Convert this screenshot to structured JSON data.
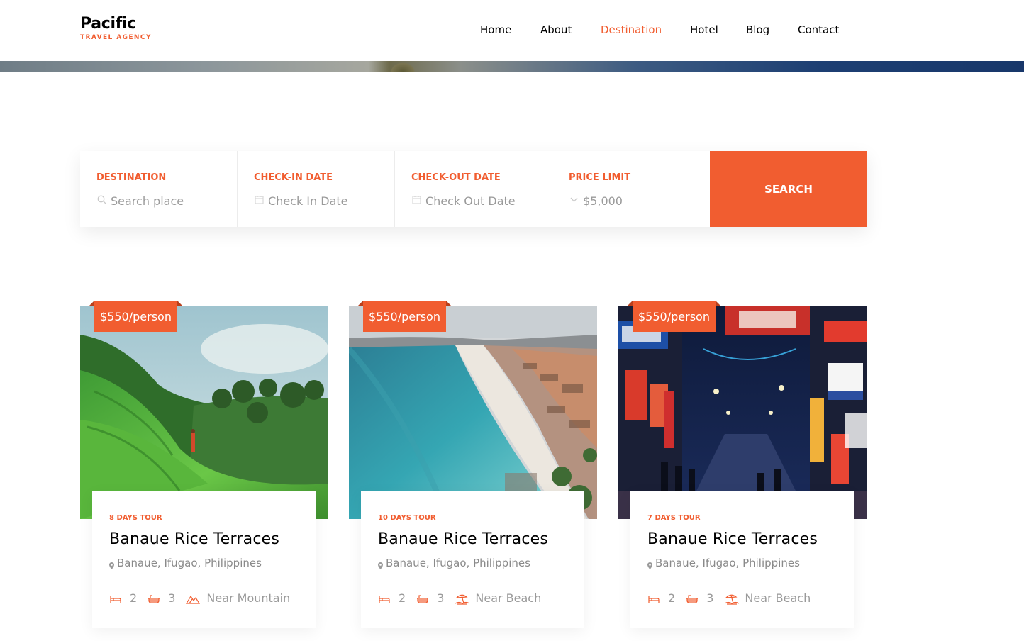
{
  "brand": {
    "name": "Pacific",
    "tagline": "TRAVEL AGENCY"
  },
  "nav": {
    "items": [
      "Home",
      "About",
      "Destination",
      "Hotel",
      "Blog",
      "Contact"
    ],
    "active": "Destination"
  },
  "search": {
    "destination": {
      "label": "DESTINATION",
      "placeholder": "Search place",
      "icon": "search-icon"
    },
    "checkin": {
      "label": "CHECK-IN DATE",
      "placeholder": "Check In Date",
      "icon": "calendar-icon"
    },
    "checkout": {
      "label": "CHECK-OUT DATE",
      "placeholder": "Check Out Date",
      "icon": "calendar-icon"
    },
    "price": {
      "label": "PRICE LIMIT",
      "value": "$5,000",
      "icon": "chevron-down-icon"
    },
    "button": "SEARCH"
  },
  "colors": {
    "accent": "#f15d30",
    "text": "#000000",
    "muted": "#9a9a9a"
  },
  "cards": [
    {
      "price": "$550/person",
      "days": "8 DAYS TOUR",
      "title": "Banaue Rice Terraces",
      "location": "Banaue, Ifugao, Philippines",
      "beds": "2",
      "baths": "3",
      "feature": "Near Mountain",
      "feature_icon": "mountain-icon",
      "image": "rice-terraces"
    },
    {
      "price": "$550/person",
      "days": "10 DAYS TOUR",
      "title": "Banaue Rice Terraces",
      "location": "Banaue, Ifugao, Philippines",
      "beds": "2",
      "baths": "3",
      "feature": "Near Beach",
      "feature_icon": "beach-icon",
      "image": "beach-coast"
    },
    {
      "price": "$550/person",
      "days": "7 DAYS TOUR",
      "title": "Banaue Rice Terraces",
      "location": "Banaue, Ifugao, Philippines",
      "beds": "2",
      "baths": "3",
      "feature": "Near Beach",
      "feature_icon": "beach-icon",
      "image": "city-street"
    }
  ]
}
